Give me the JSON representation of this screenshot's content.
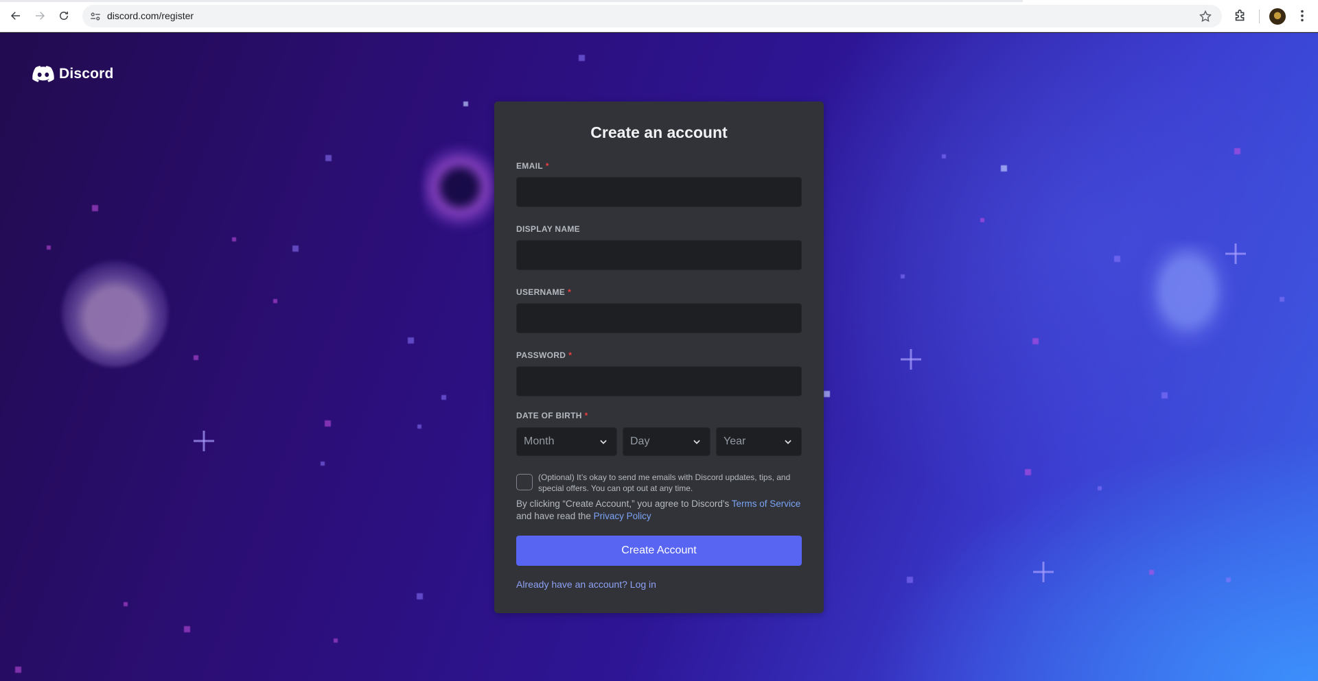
{
  "browser": {
    "url": "discord.com/register",
    "icons": {
      "back": "arrow-left-icon",
      "forward": "arrow-right-icon",
      "reload": "reload-icon",
      "site_info": "site-settings-icon",
      "bookmark": "star-icon",
      "extensions": "puzzle-icon",
      "menu": "kebab-menu-icon"
    }
  },
  "brand": {
    "name": "Discord",
    "icon": "discord-logo-icon"
  },
  "form": {
    "title": "Create an account",
    "email_label": "EMAIL",
    "display_name_label": "DISPLAY NAME",
    "username_label": "USERNAME",
    "password_label": "PASSWORD",
    "dob_label": "DATE OF BIRTH",
    "required_mark": "*",
    "month_placeholder": "Month",
    "day_placeholder": "Day",
    "year_placeholder": "Year",
    "optin_text": "(Optional) It’s okay to send me emails with Discord updates, tips, and special offers. You can opt out at any time.",
    "terms_prefix": "By clicking “Create Account,” you agree to Discord's",
    "terms_link": "Terms of Service",
    "terms_middle": "and have read the",
    "privacy_link": "Privacy Policy",
    "submit_label": "Create Account",
    "login_link": "Already have an account? Log in"
  },
  "colors": {
    "card_bg": "#313338",
    "input_bg": "#1e1f22",
    "brand_blurple": "#5865f2",
    "required_red": "#f23f42",
    "link_blue": "#7ba4f5"
  }
}
